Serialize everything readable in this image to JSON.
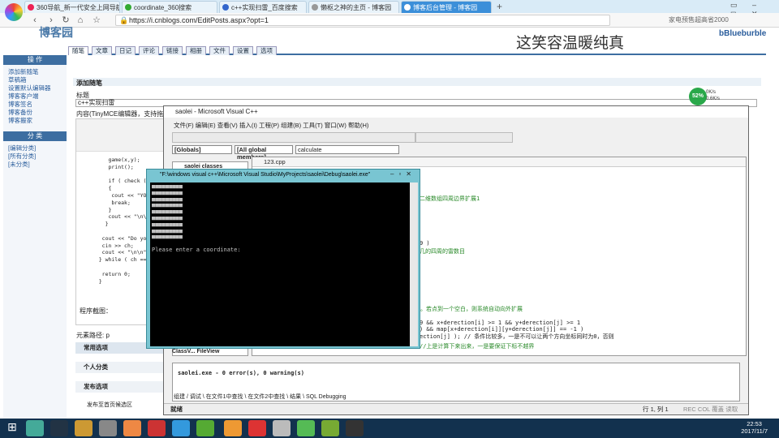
{
  "browser": {
    "tabs": [
      {
        "label": "360导航_新一代安全上网导航"
      },
      {
        "label": "coordinate_360搜索"
      },
      {
        "label": "c++实现扫雷_百度搜索"
      },
      {
        "label": "懒枢之神的主页 - 博客园"
      },
      {
        "label": "博客后台管理 - 博客园"
      }
    ],
    "url": "https://i.cnblogs.com/EditPosts.aspx?opt=1",
    "right_hint": "家电预售超高省2000"
  },
  "blog": {
    "site_title": "这笑容温暖纯真",
    "user": "bBlueburble",
    "logo_text": "博客园",
    "main_tabs": [
      "随笔",
      "文章",
      "日记",
      "评论",
      "链接",
      "相册",
      "文件",
      "设置",
      "选项"
    ],
    "left_header_ops": "操 作",
    "left_ops": [
      "添加新随笔",
      "草稿箱",
      "设置默认编辑器",
      "博客客户端",
      "博客签名",
      "博客备份",
      "博客搬家"
    ],
    "left_header_cat": "分 类",
    "left_cats": [
      "[编辑分类]",
      "[所有分类]",
      "[未分类]"
    ],
    "add_post": "添加随笔",
    "title_label": "标题",
    "title_value": "c++实现扫雷",
    "content_label": "内容(TinyMCE编辑器，支持拖放/粘贴上传图片)",
    "program_shot": "程序截图：",
    "element_path": "元素路径: p",
    "common_options": "常用选项",
    "personal_cat": "个人分类",
    "publish_opts": "发布选项",
    "publish_home": "发布至首页候选区",
    "left_code": "      game(x,y);\n      print();\n\n      if ( check ( ) )\n      {\n       cout << \"YOU W\n       break;\n      }\n      cout << \"\\n\\n\";\n     }\n\n    cout << \"Do you\n    cin >> ch;\n    cout << \"\\n\\n\";\n   } while ( ch == \"\n\n    return 0;\n   }"
  },
  "vc": {
    "title": "saolei - Microsoft Visual C++",
    "menu": "文件(F)  编辑(E)  查看(V)  插入(I)  工程(P)  组建(B)  工具(T)  窗口(W)  帮助(H)",
    "combo_globals": "[Globals]",
    "combo_members": "[All global members]",
    "combo_func": "calculate",
    "doc_name": "123.cpp",
    "class_tab": "saolei classes",
    "code_lines": [
      "二维数组四周边界扩展1",
      "9 )",
      "几的四周的雷数目",
      "程。若点到一个空白，则系统自动向外扩展",
      "9 && x+derection[i] >= 1 && y+derection[j] >= 1",
      ") &&  map[x+derection[i]][y+derection[j]] == -1 )",
      "ection[j] ); // 条件比较多，一是不可以让两个方向坐标同时为0，否则",
      "    //上是计算下来出来，一是要保证下标不越界"
    ],
    "output": "saolei.exe - 0 error(s), 0 warning(s)",
    "bottom_tabs": "组建 / 调试 \\ 在文件1中查找 \\ 在文件2中查找 \\ 结果 \\ SQL Debugging",
    "classview": "ClassV...",
    "fileview": "FileView",
    "status": "就绪",
    "rowcol": "行 1, 列 1",
    "flags": "REC COL 覆盖 读取"
  },
  "console": {
    "title": "\"F:\\windows visual c++\\Microsoft Visual Studio\\MyProjects\\saolei\\Debug\\saolei.exe\"",
    "body": "■■■■■■■■■\n■■■■■■■■■\n■■■■■■■■■\n■■■■■■■■■\n■■■■■■■■■\n■■■■■■■■■\n■■■■■■■■■\n■■■■■■■■■\n■■■■■■■■■\n\nPlease enter a coordinate:"
  },
  "widget": {
    "percent": "52%",
    "extra": "0K/s\n0.6K/s"
  },
  "clock": {
    "time": "22:53",
    "date": "2017/11/7"
  },
  "colors": {
    "accent": "#3d6ea1",
    "console_border": "#79c5d2",
    "taskbar": "#12314e"
  }
}
